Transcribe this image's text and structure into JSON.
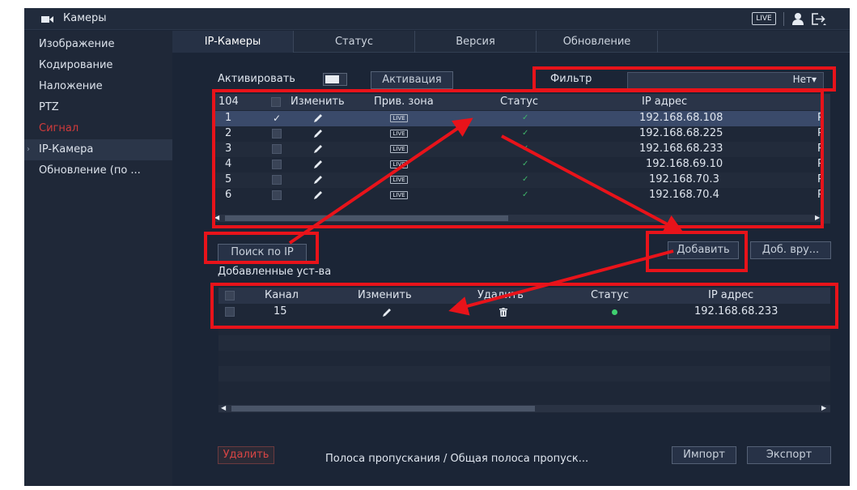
{
  "topbar": {
    "title": "Камеры",
    "live_badge": "LIVE"
  },
  "sidebar": {
    "items": [
      {
        "label": "Изображение"
      },
      {
        "label": "Кодирование"
      },
      {
        "label": "Наложение"
      },
      {
        "label": "PTZ"
      },
      {
        "label": "Сигнал"
      },
      {
        "label": "IP-Камера"
      },
      {
        "label": "Обновление (по ..."
      }
    ]
  },
  "tabs": [
    {
      "label": "IP-Камеры"
    },
    {
      "label": "Статус"
    },
    {
      "label": "Версия"
    },
    {
      "label": "Обновление"
    }
  ],
  "activate": {
    "label": "Активировать",
    "button": "Активация"
  },
  "filter": {
    "label": "Фильтр",
    "value": "Нет▾"
  },
  "device_table": {
    "headers": {
      "count": "104",
      "edit": "Изменить",
      "live": "Прив. зона",
      "status": "Статус",
      "ip": "IP адрес"
    },
    "rows": [
      {
        "no": "1",
        "ip": "192.168.68.108"
      },
      {
        "no": "2",
        "ip": "192.168.68.225"
      },
      {
        "no": "3",
        "ip": "192.168.68.233"
      },
      {
        "no": "4",
        "ip": "192.168.69.10"
      },
      {
        "no": "5",
        "ip": "192.168.70.3"
      },
      {
        "no": "6",
        "ip": "192.168.70.4"
      }
    ],
    "live_badge": "LIVE",
    "cut_col": "P"
  },
  "buttons": {
    "search_ip": "Поиск по IP",
    "add": "Добавить",
    "manual_add": "Доб. вру...",
    "delete": "Удалить",
    "import": "Импорт",
    "export": "Экспорт"
  },
  "added": {
    "title": "Добавленные уст-ва",
    "headers": {
      "channel": "Канал",
      "edit": "Изменить",
      "delete": "Удалить",
      "status": "Статус",
      "ip": "IP адрес"
    },
    "rows": [
      {
        "channel": "15",
        "ip": "192.168.68.233"
      }
    ]
  },
  "footer": {
    "bandwidth": "Полоса пропускания / Общая полоса пропуск..."
  },
  "colors": {
    "annotation_red": "#e8131a",
    "sidebar_active_red": "#d23b3b",
    "status_green": "#3fd070"
  },
  "icons": [
    "camera-icon",
    "user-icon",
    "exit-icon",
    "pencil-icon",
    "trash-icon",
    "checkmark-icon",
    "live-icon"
  ]
}
